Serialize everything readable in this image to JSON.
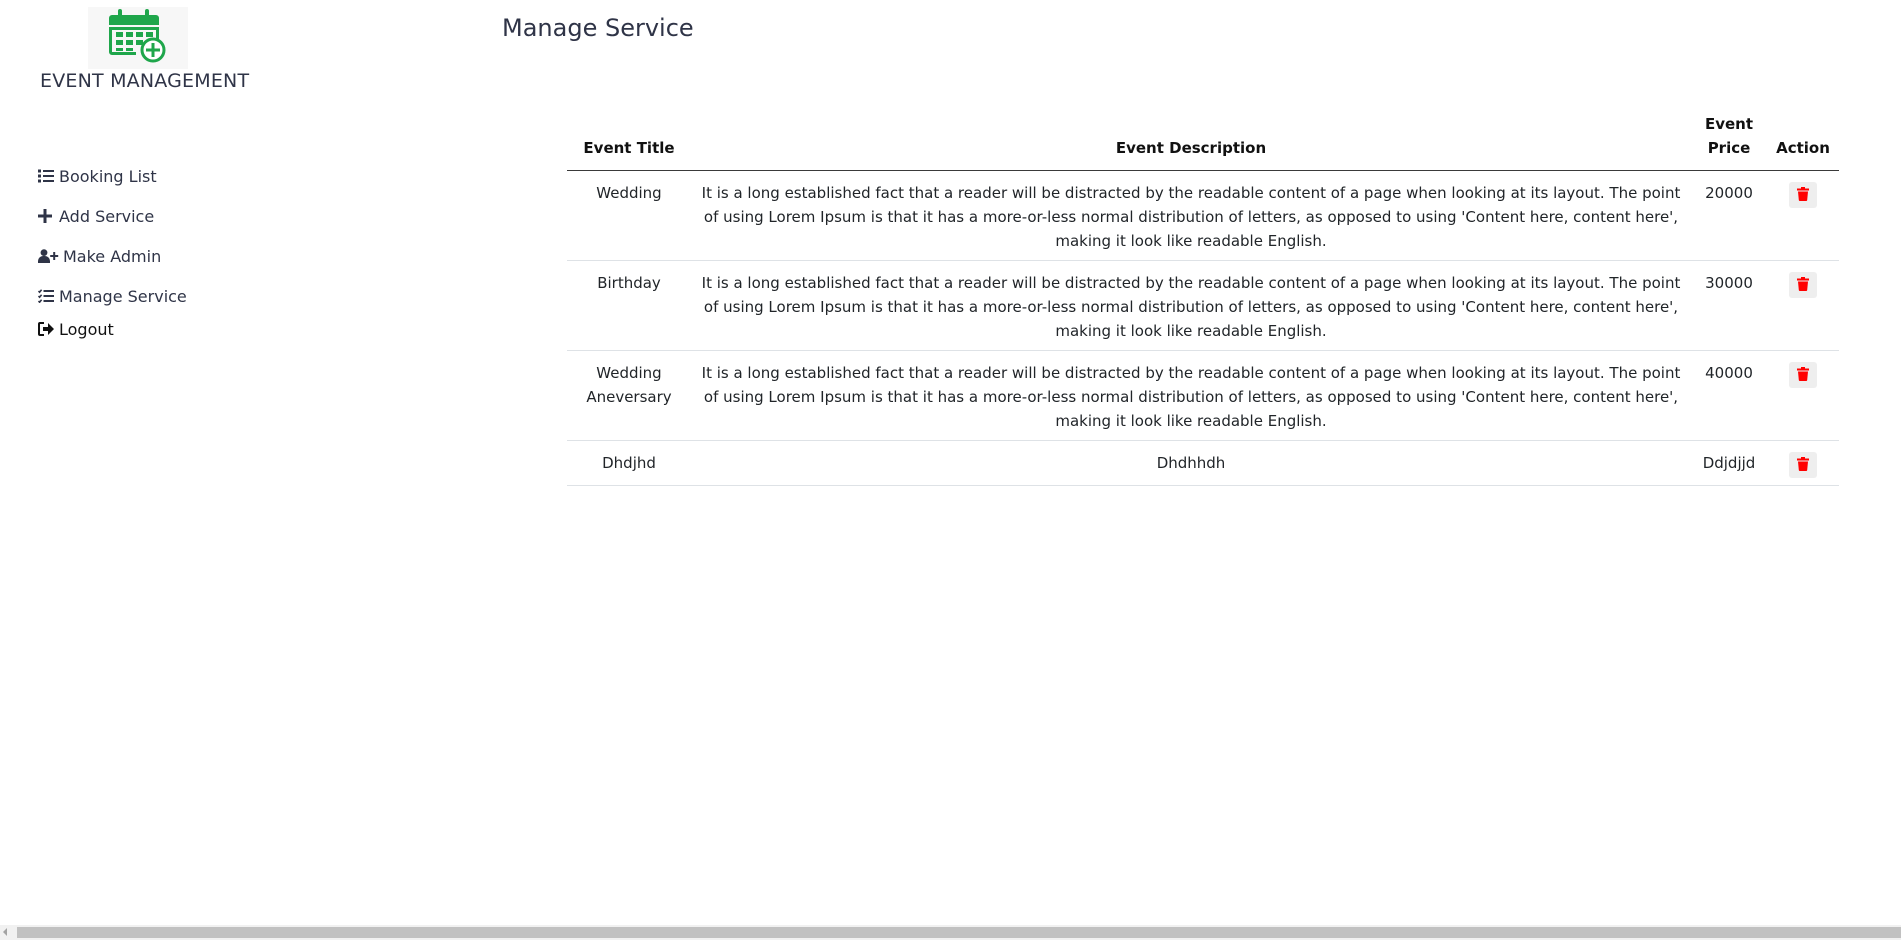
{
  "brand": {
    "name": "EVENT MANAGEMENT",
    "logo_icon": "calendar-plus-icon",
    "logo_color": "#1fa64b"
  },
  "sidebar": {
    "items": [
      {
        "label": "Booking List",
        "icon": "list-icon"
      },
      {
        "label": "Add Service",
        "icon": "plus-icon"
      },
      {
        "label": "Make Admin",
        "icon": "user-plus-icon"
      },
      {
        "label": "Manage Service",
        "icon": "tasks-icon"
      },
      {
        "label": "Logout",
        "icon": "sign-out-icon"
      }
    ]
  },
  "main": {
    "title": "Manage Service",
    "table": {
      "headers": {
        "title": "Event Title",
        "description": "Event Description",
        "price": "Event Price",
        "action": "Action"
      },
      "rows": [
        {
          "title": "Wedding",
          "description": "It is a long established fact that a reader will be distracted by the readable content of a page when looking at its layout. The point of using Lorem Ipsum is that it has a more-or-less normal distribution of letters, as opposed to using 'Content here, content here', making it look like readable English.",
          "price": "20000"
        },
        {
          "title": "Birthday",
          "description": "It is a long established fact that a reader will be distracted by the readable content of a page when looking at its layout. The point of using Lorem Ipsum is that it has a more-or-less normal distribution of letters, as opposed to using 'Content here, content here', making it look like readable English.",
          "price": "30000"
        },
        {
          "title": "Wedding Aneversary",
          "description": "It is a long established fact that a reader will be distracted by the readable content of a page when looking at its layout. The point of using Lorem Ipsum is that it has a more-or-less normal distribution of letters, as opposed to using 'Content here, content here', making it look like readable English.",
          "price": "40000"
        },
        {
          "title": "Dhdjhd",
          "description": "Dhdhhdh",
          "price": "Ddjdjjd"
        }
      ],
      "delete_icon": "trash-icon",
      "delete_color": "#ff0000"
    }
  }
}
